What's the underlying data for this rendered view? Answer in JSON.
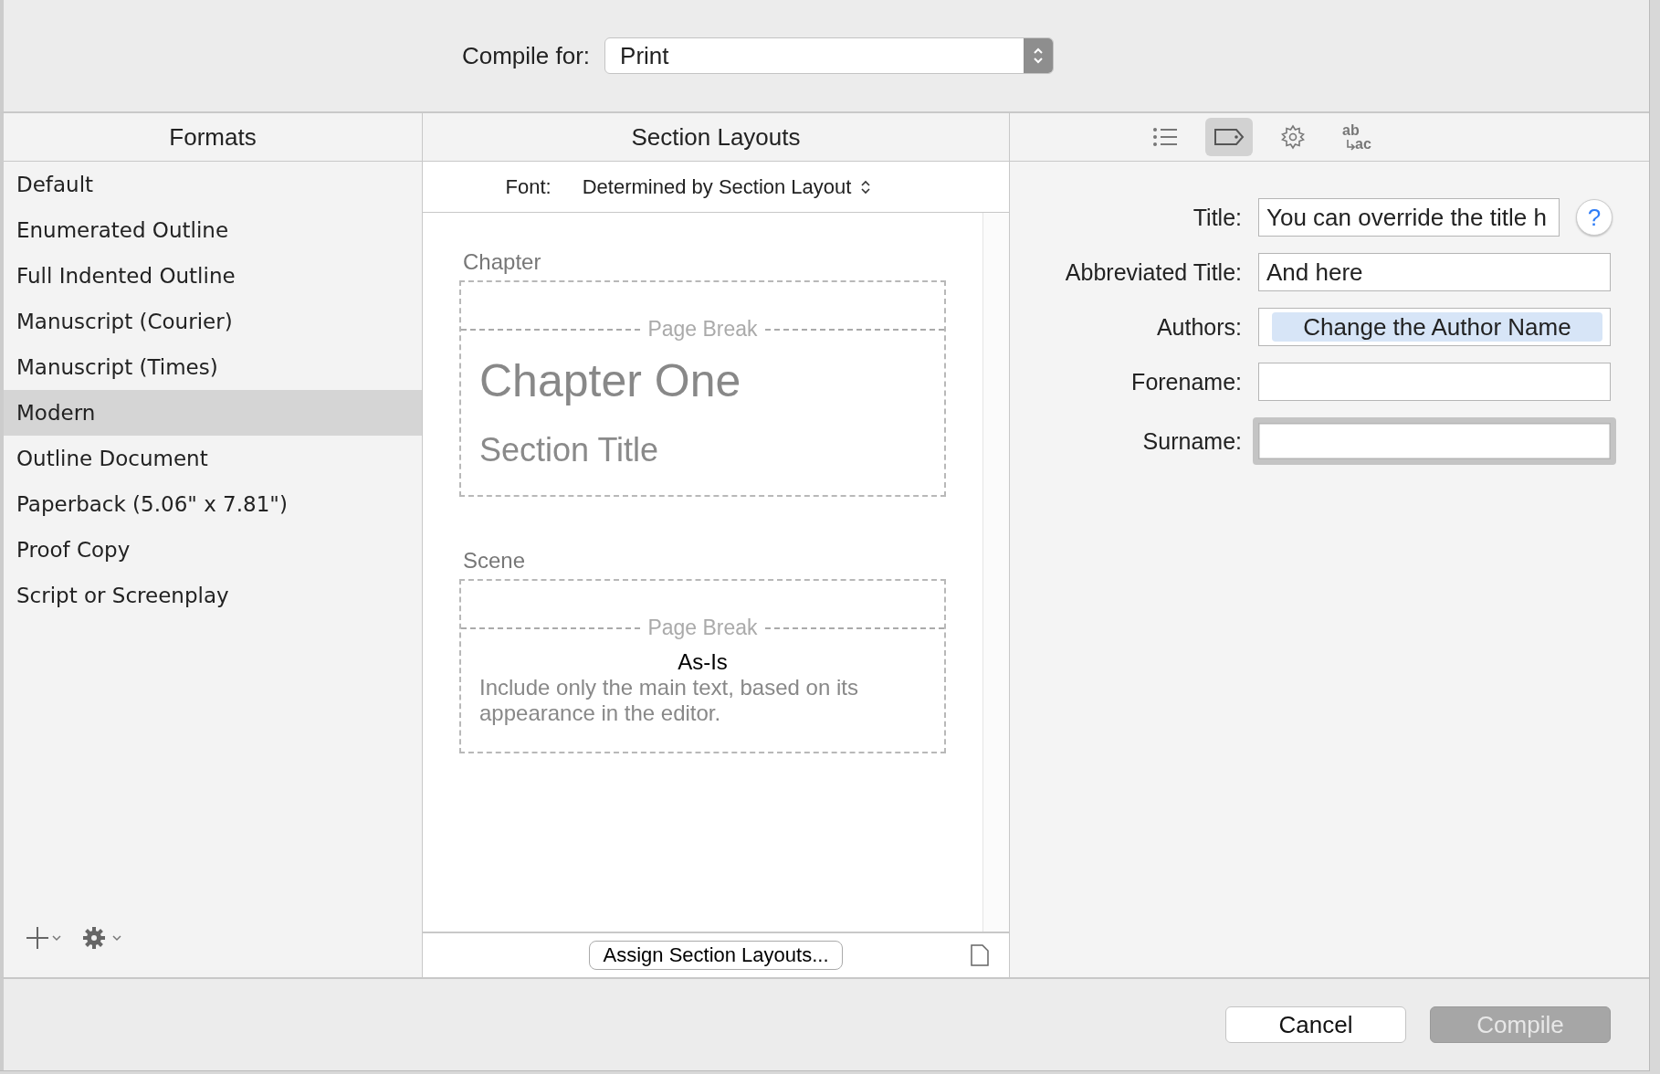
{
  "compile_for": {
    "label": "Compile for:",
    "value": "Print"
  },
  "formats": {
    "header": "Formats",
    "items": [
      {
        "label": "Default",
        "selected": false
      },
      {
        "label": "Enumerated Outline",
        "selected": false
      },
      {
        "label": "Full Indented Outline",
        "selected": false
      },
      {
        "label": "Manuscript (Courier)",
        "selected": false
      },
      {
        "label": "Manuscript (Times)",
        "selected": false
      },
      {
        "label": "Modern",
        "selected": true
      },
      {
        "label": "Outline Document",
        "selected": false
      },
      {
        "label": "Paperback (5.06\" x 7.81\")",
        "selected": false
      },
      {
        "label": "Proof Copy",
        "selected": false
      },
      {
        "label": "Script or Screenplay",
        "selected": false
      }
    ]
  },
  "section_layouts": {
    "header": "Section Layouts",
    "font_label": "Font:",
    "font_value": "Determined by Section Layout",
    "sections": [
      {
        "name": "Chapter",
        "page_break": "Page Break",
        "kind": "titled",
        "heading": "Chapter One",
        "subheading": "Section Title"
      },
      {
        "name": "Scene",
        "page_break": "Page Break",
        "kind": "text",
        "heading": "As-Is",
        "body": "Include only the main text, based on its appearance in the editor."
      }
    ],
    "assign_button": "Assign Section Layouts..."
  },
  "inspector": {
    "tabs": [
      {
        "kind": "list",
        "selected": false
      },
      {
        "kind": "tag",
        "selected": true
      },
      {
        "kind": "gear",
        "selected": false
      },
      {
        "kind": "replace",
        "selected": false,
        "top": "ab",
        "bottom": "ac"
      }
    ],
    "fields": [
      {
        "label": "Title:",
        "kind": "text",
        "value": "You can override the title h",
        "help": true,
        "focused": false
      },
      {
        "label": "Abbreviated Title:",
        "kind": "text",
        "value": "And here",
        "help": false,
        "focused": false
      },
      {
        "label": "Authors:",
        "kind": "token",
        "value": "Change the Author Name",
        "help": false,
        "focused": false
      },
      {
        "label": "Forename:",
        "kind": "text",
        "help": false,
        "focused": false
      },
      {
        "label": "Surname:",
        "kind": "text",
        "help": false,
        "focused": true
      }
    ]
  },
  "help_glyph": "?",
  "buttons": [
    {
      "label": "Cancel",
      "disabled": false
    },
    {
      "label": "Compile",
      "disabled": true
    }
  ]
}
